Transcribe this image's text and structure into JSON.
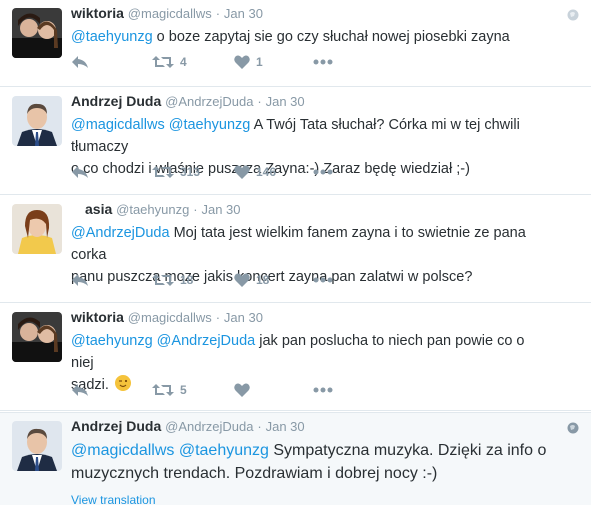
{
  "tweets": [
    {
      "fullname": "wiktoria",
      "username": "@magicdallws",
      "dot": "·",
      "time": "Jan 30",
      "mentions": [
        "@taehyunzg"
      ],
      "text": " o boze zapytaj sie go czy słuchał nowej piosebki zayna",
      "retweets": "4",
      "likes": "1"
    },
    {
      "fullname": "Andrzej Duda",
      "username": "@AndrzejDuda",
      "dot": "·",
      "time": "Jan 30",
      "mentions": [
        "@magicdallws",
        "@taehyunzg"
      ],
      "text_line1": " A Twój Tata słuchał? Córka mi w tej chwili tłumaczy",
      "text_line2": "o co chodzi i właśnie puszcza Zayna:-) Zaraz będę wiedział ;-)",
      "retweets": "313",
      "likes": "146"
    },
    {
      "fullname": "asia",
      "username": "@taehyunzg",
      "dot": "·",
      "time": "Jan 30",
      "mentions": [
        "@AndrzejDuda"
      ],
      "text_line1": " Moj tata jest wielkim fanem zayna i to swietnie ze pana corka",
      "text_line2": "panu puszcza moze jakis koncert zayna pan zalatwi w polsce?",
      "retweets": "18",
      "likes": "18"
    },
    {
      "fullname": "wiktoria",
      "username": "@magicdallws",
      "dot": "·",
      "time": "Jan 30",
      "mentions": [
        "@taehyunzg",
        "@AndrzejDuda"
      ],
      "text_line1": " jak pan poslucha to niech pan powie co o niej",
      "text_line2": "sądzi.",
      "retweets": "5",
      "likes": ""
    },
    {
      "fullname": "Andrzej Duda",
      "username": "@AndrzejDuda",
      "dot": "·",
      "time": "Jan 30",
      "mentions": [
        "@magicdallws",
        "@taehyunzg"
      ],
      "text_line1": " Sympatyczna muzyka. Dzięki za info o",
      "text_line2": "muzycznych trendach. Pozdrawiam i dobrej nocy :-)",
      "view_translation": "View translation"
    }
  ],
  "icons": {
    "reply": "reply-icon",
    "retweet": "retweet-icon",
    "like": "heart-icon",
    "more": "more-icon",
    "globe": "globe-icon"
  },
  "colors": {
    "mention": "#1b95e0",
    "meta": "#8899a6",
    "text": "#292f33"
  }
}
